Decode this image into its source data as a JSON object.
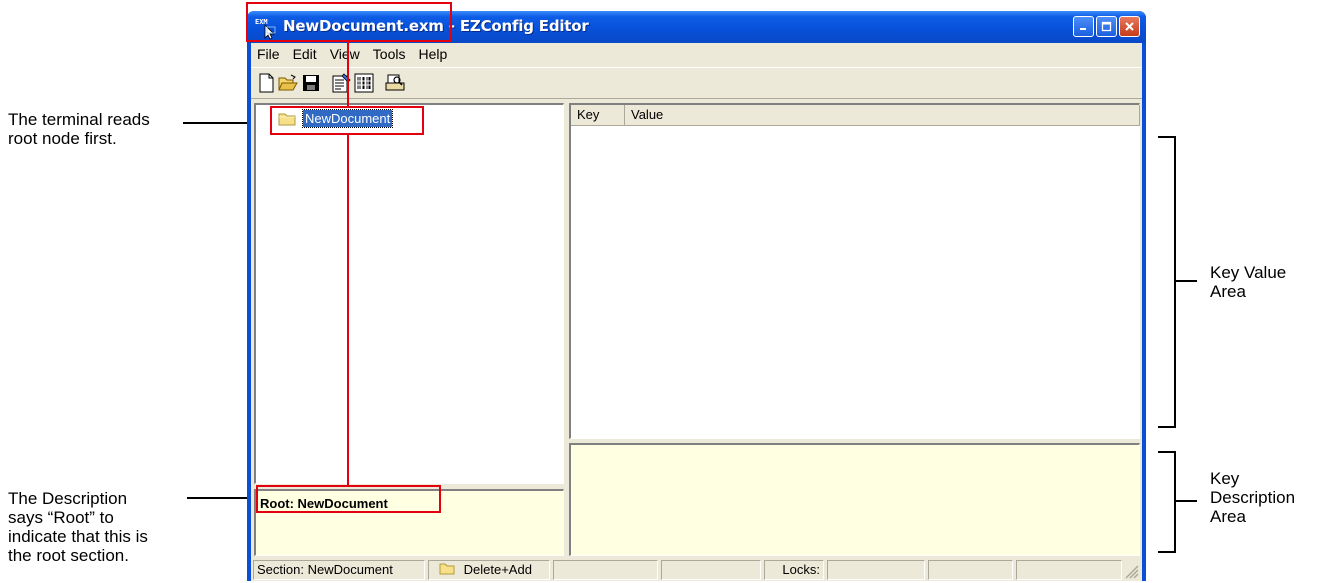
{
  "window": {
    "title_file": "NewDocument.exm",
    "title_app": "EZConfig Editor",
    "title_separator": "-",
    "icon_label": "EXM"
  },
  "menu": [
    "File",
    "Edit",
    "View",
    "Tools",
    "Help"
  ],
  "toolbar": {
    "icons": [
      "new-document-icon",
      "open-folder-icon",
      "save-icon",
      "properties-icon",
      "barcode-icon",
      "print-preview-icon"
    ]
  },
  "tree": {
    "root_label": "NewDocument"
  },
  "description": {
    "text": "Root: NewDocument"
  },
  "key_value": {
    "columns": [
      "Key",
      "Value"
    ]
  },
  "status_bar": {
    "section": "Section: NewDocument",
    "mode": "Delete+Add",
    "locks": "Locks:"
  },
  "annotations": {
    "root_node_line1": "The terminal reads",
    "root_node_line2": "root node first.",
    "description_line1": "The Description",
    "description_line2": "says “Root” to",
    "description_line3": "indicate that this is",
    "description_line4": "the root section.",
    "key_value_line1": "Key Value",
    "key_value_line2": "Area",
    "key_desc_line1": "Key",
    "key_desc_line2": "Description",
    "key_desc_line3": "Area"
  },
  "colors": {
    "highlight_box": "#e3000f",
    "titlebar": "#0750d8",
    "description_background": "#ffffe1",
    "selection": "#316ac5"
  }
}
